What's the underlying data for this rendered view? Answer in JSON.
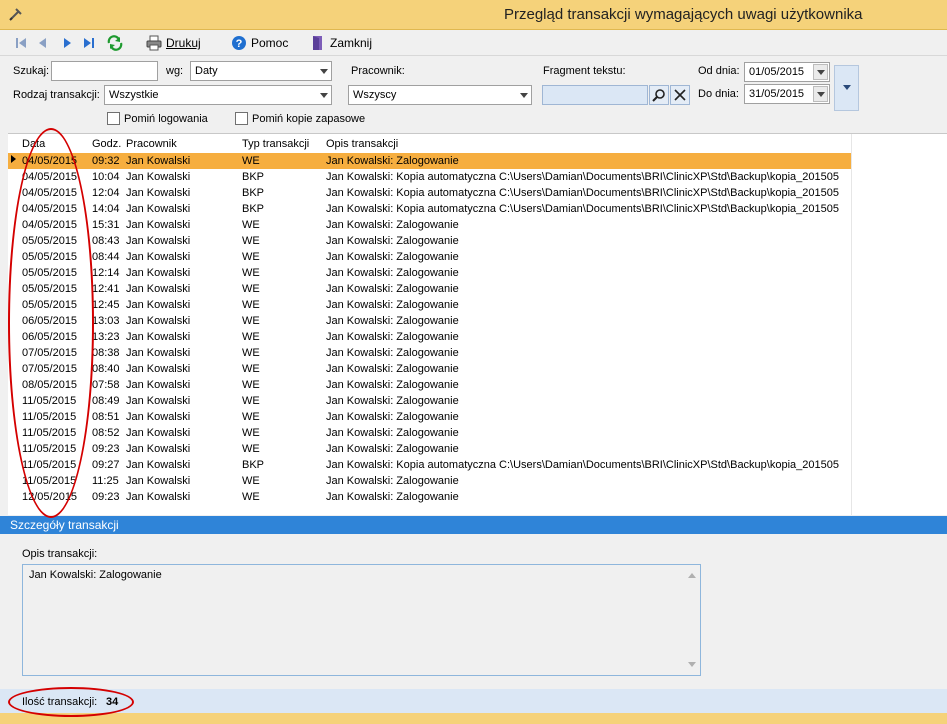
{
  "window": {
    "title": "Przegląd transakcji wymagających uwagi użytkownika"
  },
  "toolbar": {
    "first_icon": "first-record-icon",
    "prev_icon": "prev-record-icon",
    "next_icon": "next-record-icon",
    "last_icon": "last-record-icon",
    "refresh_icon": "refresh-icon",
    "print_label": "Drukuj",
    "help_label": "Pomoc",
    "close_label": "Zamknij"
  },
  "filters": {
    "search_label": "Szukaj:",
    "search_value": "",
    "by_label": "wg:",
    "by_value": "Daty",
    "employee_label": "Pracownik:",
    "employee_value": "Wszyscy",
    "text_fragment_label": "Fragment tekstu:",
    "text_fragment_value": "",
    "from_label": "Od dnia:",
    "from_value": "01/05/2015",
    "to_label": "Do dnia:",
    "to_value": "31/05/2015",
    "type_label": "Rodzaj transakcji:",
    "type_value": "Wszystkie",
    "skip_logins_label": "Pomiń logowania",
    "skip_logins_checked": false,
    "skip_backups_label": "Pomiń kopie zapasowe",
    "skip_backups_checked": false
  },
  "grid": {
    "columns": [
      "Data",
      "Godz.",
      "Pracownik",
      "Typ transakcji",
      "Opis transakcji"
    ],
    "selected_index": 0,
    "rows": [
      {
        "date": "04/05/2015",
        "time": "09:32",
        "employee": "Jan Kowalski",
        "type": "WE",
        "desc": "Jan Kowalski: Zalogowanie"
      },
      {
        "date": "04/05/2015",
        "time": "10:04",
        "employee": "Jan Kowalski",
        "type": "BKP",
        "desc": "Jan Kowalski: Kopia automatyczna C:\\Users\\Damian\\Documents\\BRI\\ClinicXP\\Std\\Backup\\kopia_201505"
      },
      {
        "date": "04/05/2015",
        "time": "12:04",
        "employee": "Jan Kowalski",
        "type": "BKP",
        "desc": "Jan Kowalski: Kopia automatyczna C:\\Users\\Damian\\Documents\\BRI\\ClinicXP\\Std\\Backup\\kopia_201505"
      },
      {
        "date": "04/05/2015",
        "time": "14:04",
        "employee": "Jan Kowalski",
        "type": "BKP",
        "desc": "Jan Kowalski: Kopia automatyczna C:\\Users\\Damian\\Documents\\BRI\\ClinicXP\\Std\\Backup\\kopia_201505"
      },
      {
        "date": "04/05/2015",
        "time": "15:31",
        "employee": "Jan Kowalski",
        "type": "WE",
        "desc": "Jan Kowalski: Zalogowanie"
      },
      {
        "date": "05/05/2015",
        "time": "08:43",
        "employee": "Jan Kowalski",
        "type": "WE",
        "desc": "Jan Kowalski: Zalogowanie"
      },
      {
        "date": "05/05/2015",
        "time": "08:44",
        "employee": "Jan Kowalski",
        "type": "WE",
        "desc": "Jan Kowalski: Zalogowanie"
      },
      {
        "date": "05/05/2015",
        "time": "12:14",
        "employee": "Jan Kowalski",
        "type": "WE",
        "desc": "Jan Kowalski: Zalogowanie"
      },
      {
        "date": "05/05/2015",
        "time": "12:41",
        "employee": "Jan Kowalski",
        "type": "WE",
        "desc": "Jan Kowalski: Zalogowanie"
      },
      {
        "date": "05/05/2015",
        "time": "12:45",
        "employee": "Jan Kowalski",
        "type": "WE",
        "desc": "Jan Kowalski: Zalogowanie"
      },
      {
        "date": "06/05/2015",
        "time": "13:03",
        "employee": "Jan Kowalski",
        "type": "WE",
        "desc": "Jan Kowalski: Zalogowanie"
      },
      {
        "date": "06/05/2015",
        "time": "13:23",
        "employee": "Jan Kowalski",
        "type": "WE",
        "desc": "Jan Kowalski: Zalogowanie"
      },
      {
        "date": "07/05/2015",
        "time": "08:38",
        "employee": "Jan Kowalski",
        "type": "WE",
        "desc": "Jan Kowalski: Zalogowanie"
      },
      {
        "date": "07/05/2015",
        "time": "08:40",
        "employee": "Jan Kowalski",
        "type": "WE",
        "desc": "Jan Kowalski: Zalogowanie"
      },
      {
        "date": "08/05/2015",
        "time": "07:58",
        "employee": "Jan Kowalski",
        "type": "WE",
        "desc": "Jan Kowalski: Zalogowanie"
      },
      {
        "date": "11/05/2015",
        "time": "08:49",
        "employee": "Jan Kowalski",
        "type": "WE",
        "desc": "Jan Kowalski: Zalogowanie"
      },
      {
        "date": "11/05/2015",
        "time": "08:51",
        "employee": "Jan Kowalski",
        "type": "WE",
        "desc": "Jan Kowalski: Zalogowanie"
      },
      {
        "date": "11/05/2015",
        "time": "08:52",
        "employee": "Jan Kowalski",
        "type": "WE",
        "desc": "Jan Kowalski: Zalogowanie"
      },
      {
        "date": "11/05/2015",
        "time": "09:23",
        "employee": "Jan Kowalski",
        "type": "WE",
        "desc": "Jan Kowalski: Zalogowanie"
      },
      {
        "date": "11/05/2015",
        "time": "09:27",
        "employee": "Jan Kowalski",
        "type": "BKP",
        "desc": "Jan Kowalski: Kopia automatyczna C:\\Users\\Damian\\Documents\\BRI\\ClinicXP\\Std\\Backup\\kopia_201505"
      },
      {
        "date": "11/05/2015",
        "time": "11:25",
        "employee": "Jan Kowalski",
        "type": "WE",
        "desc": "Jan Kowalski: Zalogowanie"
      },
      {
        "date": "12/05/2015",
        "time": "09:23",
        "employee": "Jan Kowalski",
        "type": "WE",
        "desc": "Jan Kowalski: Zalogowanie"
      }
    ]
  },
  "details": {
    "header": "Szczegóły transakcji",
    "desc_label": "Opis transakcji:",
    "desc_value": "Jan Kowalski: Zalogowanie"
  },
  "status": {
    "count_label": "Ilość transakcji:",
    "count_value": "34"
  },
  "colors": {
    "titlebar": "#f5d27a",
    "selected_row": "#f6ae3f",
    "details_header": "#2f84d8",
    "annotation": "#d40000"
  }
}
